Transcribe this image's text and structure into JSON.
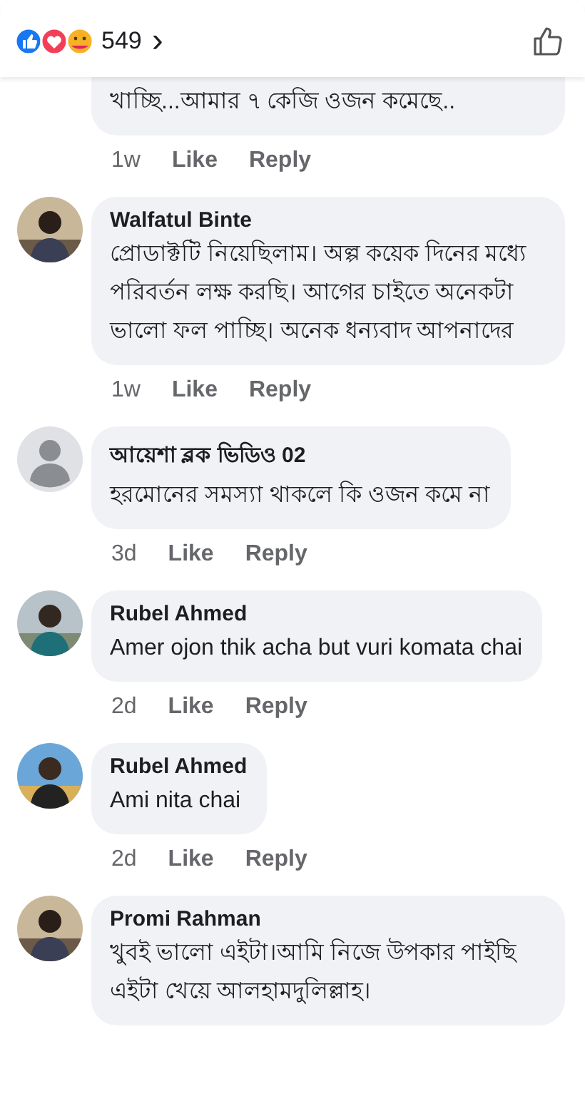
{
  "header": {
    "reaction_count": "549",
    "chevron": "›"
  },
  "comments": [
    {
      "text": "খাচ্ছি...আমার ৭ কেজি ওজন কমেছে..",
      "time": "1w",
      "like": "Like",
      "reply": "Reply",
      "cut": true
    },
    {
      "author": "Walfatul Binte",
      "text": "প্রোডাক্টটি নিয়েছিলাম। অল্প কয়েক দিনের মধ্যে পরিবর্তন লক্ষ করছি। আগের চাইতে অনেকটা ভালো ফল পাচ্ছি। অনেক ধন্যবাদ আপনাদের",
      "time": "1w",
      "like": "Like",
      "reply": "Reply",
      "kind": "picture",
      "cut": false
    },
    {
      "author": "আয়েশা ব্লক ভিডিও 02",
      "text": "হরমোনের সমস্যা থাকলে কি ওজন কমে না",
      "time": "3d",
      "like": "Like",
      "reply": "Reply",
      "kind": "default",
      "cut": false
    },
    {
      "author": "Rubel Ahmed",
      "text": "Amer ojon thik acha but vuri komata chai",
      "time": "2d",
      "like": "Like",
      "reply": "Reply",
      "kind": "picture",
      "cut": false
    },
    {
      "author": "Rubel Ahmed",
      "text": "Ami nita chai",
      "time": "2d",
      "like": "Like",
      "reply": "Reply",
      "kind": "picture",
      "cut": false
    },
    {
      "author": "Promi Rahman",
      "text": "খুবই ভালো এইটা।আমি নিজে উপকার পাইছি এইটা খেয়ে আলহামদুলিল্লাহ।",
      "kind": "picture",
      "cut": false
    }
  ]
}
